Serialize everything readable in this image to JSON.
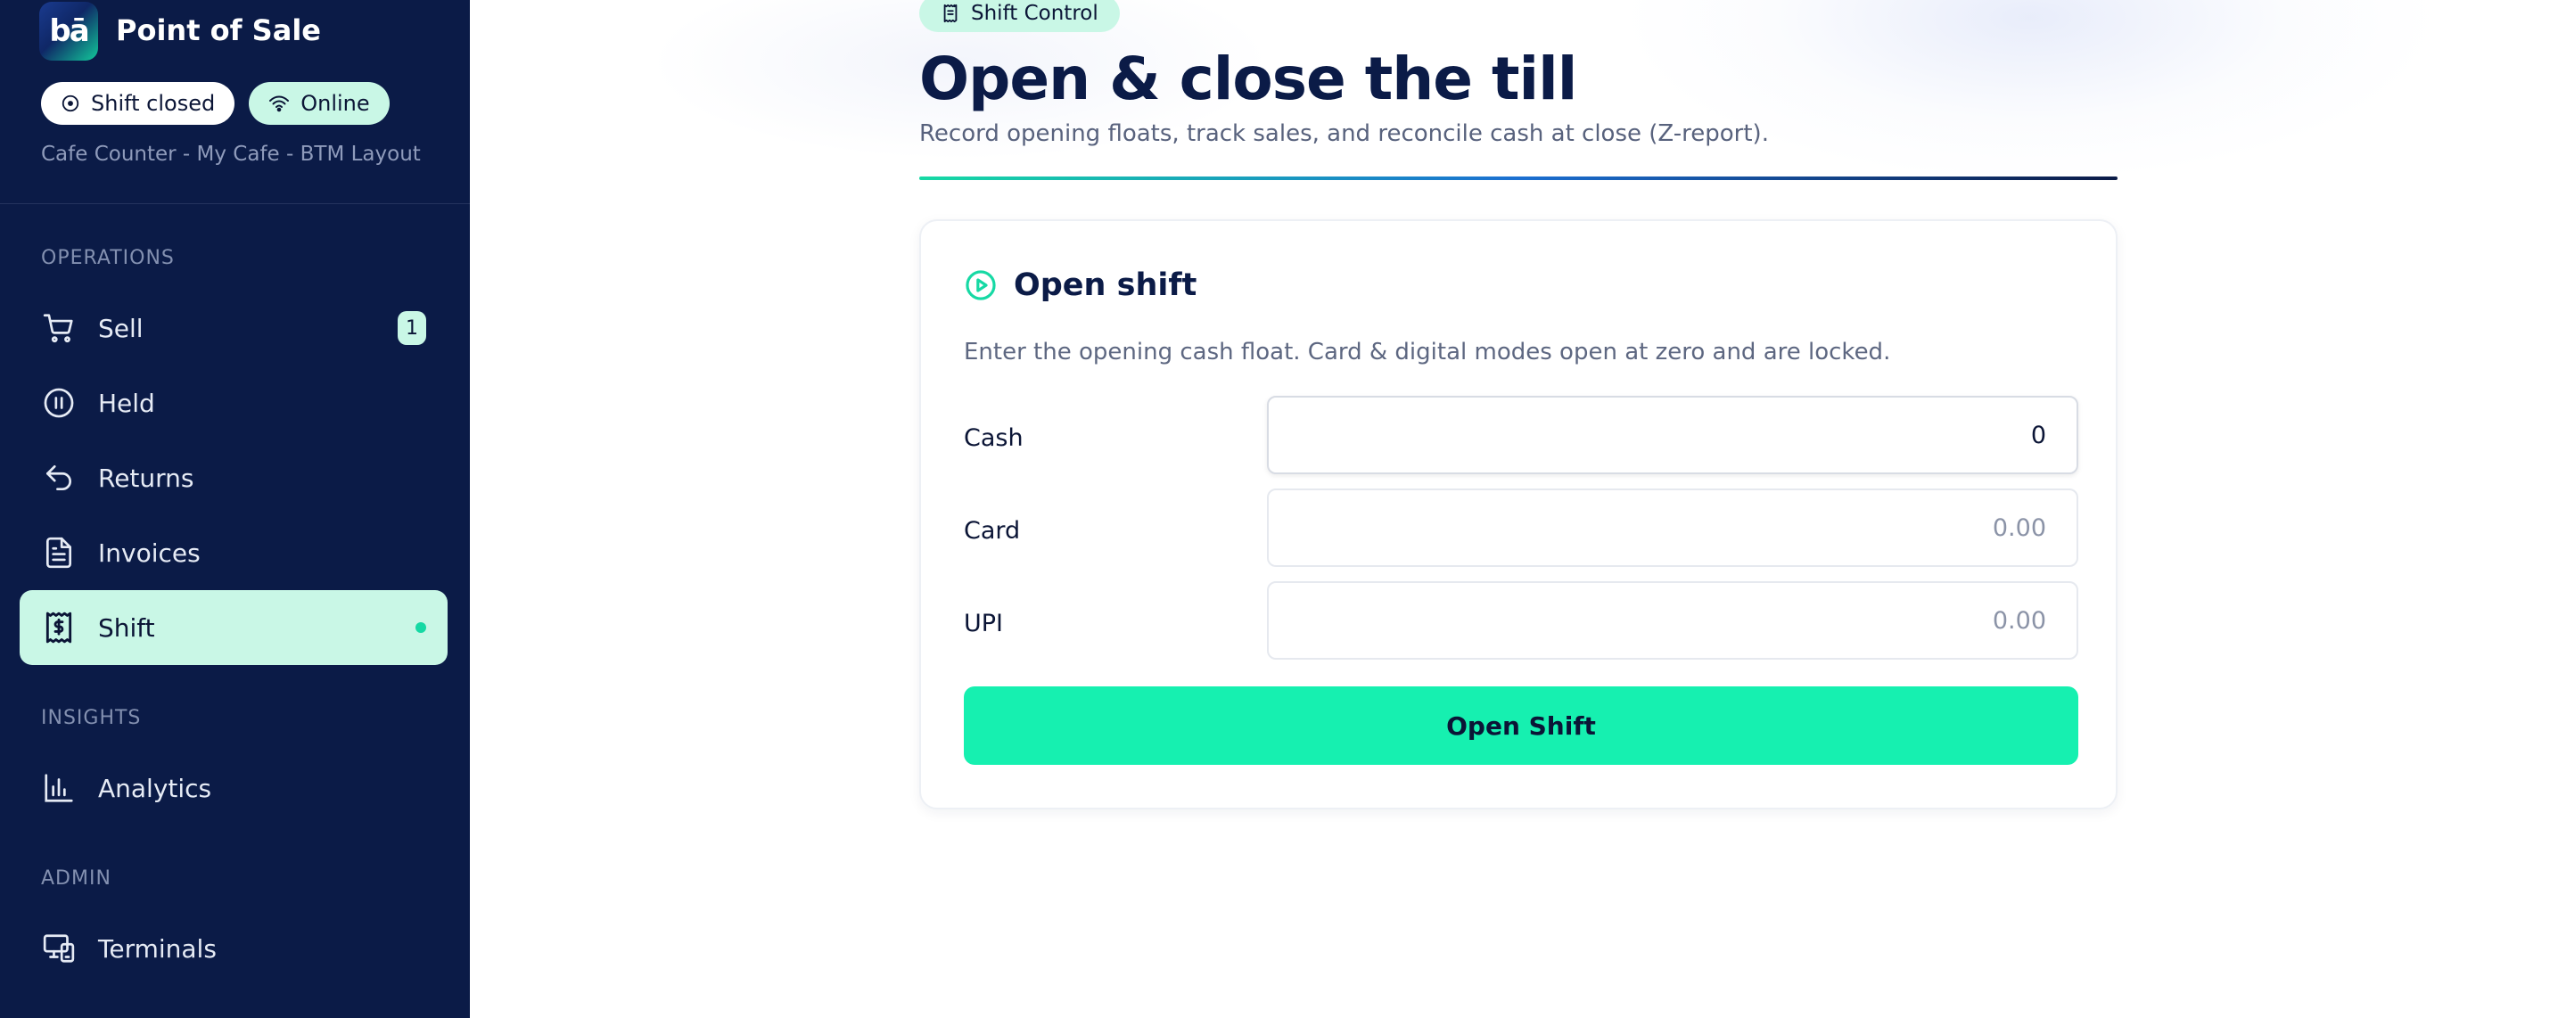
{
  "app": {
    "logo_text": "bā",
    "title": "Point of Sale"
  },
  "status": {
    "shift_label": "Shift closed",
    "network_label": "Online"
  },
  "location": "Cafe Counter - My Cafe - BTM Layout",
  "sections": {
    "operations": "OPERATIONS",
    "insights": "INSIGHTS",
    "admin": "ADMIN"
  },
  "nav": {
    "sell": {
      "label": "Sell",
      "badge": "1",
      "icon": "cart-icon"
    },
    "held": {
      "label": "Held",
      "icon": "pause-icon"
    },
    "returns": {
      "label": "Returns",
      "icon": "undo-icon"
    },
    "invoices": {
      "label": "Invoices",
      "icon": "document-icon"
    },
    "shift": {
      "label": "Shift",
      "icon": "receipt-dollar-icon",
      "active": true
    },
    "analytics": {
      "label": "Analytics",
      "icon": "bar-chart-icon"
    },
    "terminals": {
      "label": "Terminals",
      "icon": "devices-icon"
    }
  },
  "header": {
    "tag": "Shift Control",
    "title": "Open & close the till",
    "subtitle": "Record opening floats, track sales, and reconcile cash at close (Z-report)."
  },
  "open_shift": {
    "title": "Open shift",
    "description": "Enter the opening cash float. Card & digital modes open at zero and are locked.",
    "fields": {
      "cash": {
        "label": "Cash",
        "value": "0"
      },
      "card": {
        "label": "Card",
        "placeholder": "0.00"
      },
      "upi": {
        "label": "UPI",
        "placeholder": "0.00"
      }
    },
    "button_label": "Open Shift"
  },
  "colors": {
    "sidebar_bg": "#0b1b47",
    "accent": "#16f0b0",
    "accent_soft": "#c9f7e6"
  }
}
